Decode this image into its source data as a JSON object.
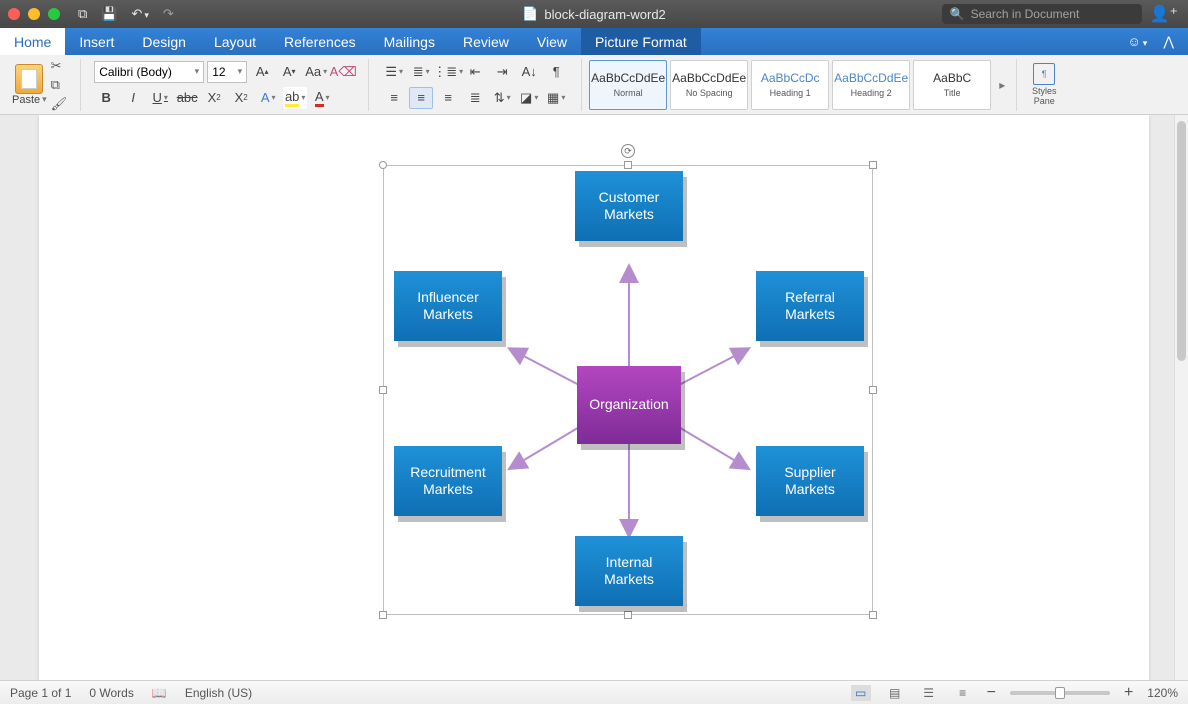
{
  "titlebar": {
    "filename": "block-diagram-word2",
    "search_placeholder": "Search in Document"
  },
  "tabs": {
    "home": "Home",
    "insert": "Insert",
    "design": "Design",
    "layout": "Layout",
    "references": "References",
    "mailings": "Mailings",
    "review": "Review",
    "view": "View",
    "picture_format": "Picture Format"
  },
  "ribbon": {
    "paste": "Paste",
    "font_name": "Calibri (Body)",
    "font_size": "12",
    "styles": [
      {
        "label": "Normal",
        "preview": "AaBbCcDdEe",
        "sel": true
      },
      {
        "label": "No Spacing",
        "preview": "AaBbCcDdEe"
      },
      {
        "label": "Heading 1",
        "preview": "AaBbCcDc",
        "blue": true
      },
      {
        "label": "Heading 2",
        "preview": "AaBbCcDdEe",
        "blue": true
      },
      {
        "label": "Title",
        "preview": "AaBbC"
      }
    ],
    "styles_pane": "Styles\nPane"
  },
  "diagram": {
    "center": "Organization",
    "nodes": {
      "top": "Customer\nMarkets",
      "tl": "Influencer\nMarkets",
      "tr": "Referral\nMarkets",
      "bl": "Recruitment\nMarkets",
      "br": "Supplier\nMarkets",
      "bottom": "Internal\nMarkets"
    }
  },
  "status": {
    "page": "Page 1 of 1",
    "words": "0 Words",
    "lang": "English (US)",
    "zoom": "120%"
  }
}
